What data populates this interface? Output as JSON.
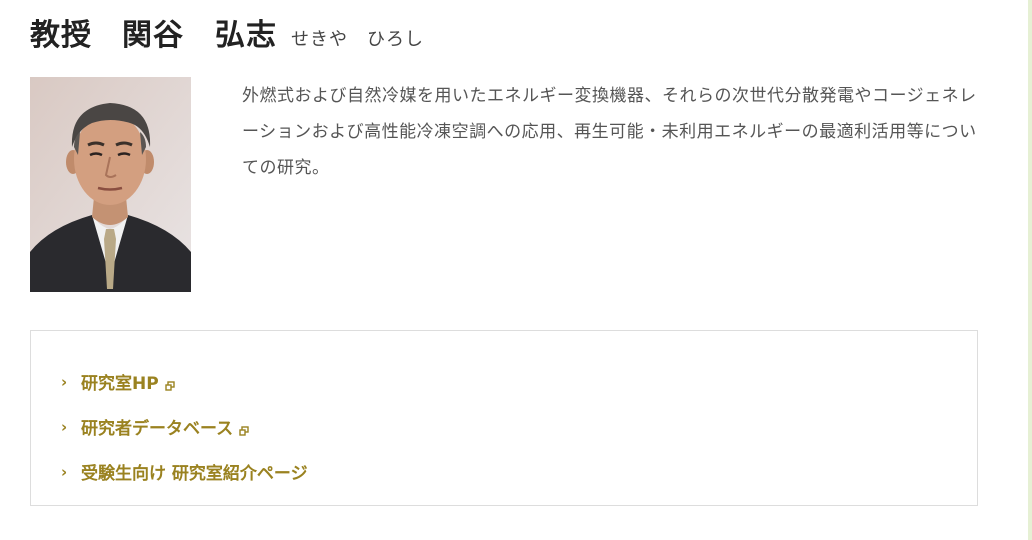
{
  "profile": {
    "role": "教授",
    "name": "関谷　弘志",
    "reading": "せきや　ひろし",
    "bio": "外燃式および自然冷媒を用いたエネルギー変換機器、それらの次世代分散発電やコージェネレーションおよび高性能冷凍空調への応用、再生可能・未利用エネルギーの最適利活用等についての研究。"
  },
  "links": [
    {
      "label": "研究室HP",
      "external": true,
      "icon": "external-link-icon"
    },
    {
      "label": "研究者データベース",
      "external": true,
      "icon": "external-link-icon"
    },
    {
      "label": "受験生向け 研究室紹介ページ",
      "external": false
    }
  ],
  "colors": {
    "link": "#9a8220",
    "box_border": "#dddddd",
    "accent_strip": "#e6f0d4"
  }
}
